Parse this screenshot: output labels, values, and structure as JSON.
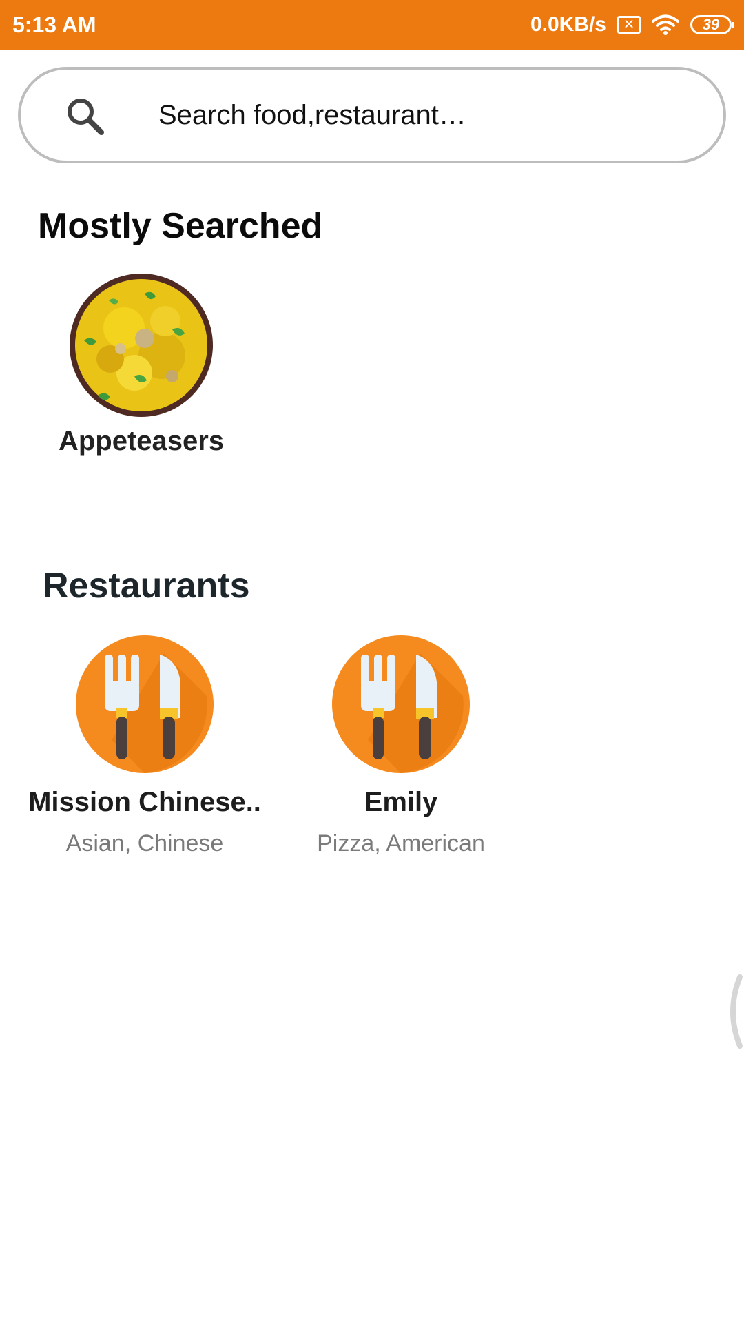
{
  "status_bar": {
    "time": "5:13 AM",
    "network_speed": "0.0KB/s",
    "sim_icon": "sim-x-icon",
    "wifi_icon": "wifi-icon",
    "battery_level": "39",
    "background_color": "#ec7a10"
  },
  "search": {
    "placeholder": "Search food,restaurant…",
    "icon": "search-icon"
  },
  "mostly_searched": {
    "title": "Mostly Searched",
    "items": [
      {
        "label": "Appeteasers",
        "image": "food-rice-image"
      }
    ]
  },
  "restaurants": {
    "title": "Restaurants",
    "items": [
      {
        "name": "Mission Chinese..",
        "cuisine": "Asian, Chinese",
        "icon": "fork-knife-icon"
      },
      {
        "name": "Emily",
        "cuisine": "Pizza, American",
        "icon": "fork-knife-icon"
      }
    ]
  },
  "colors": {
    "accent": "#ec7a10",
    "restaurant_icon_bg": "#f58b1f",
    "secondary_text": "#7a7a7a"
  }
}
